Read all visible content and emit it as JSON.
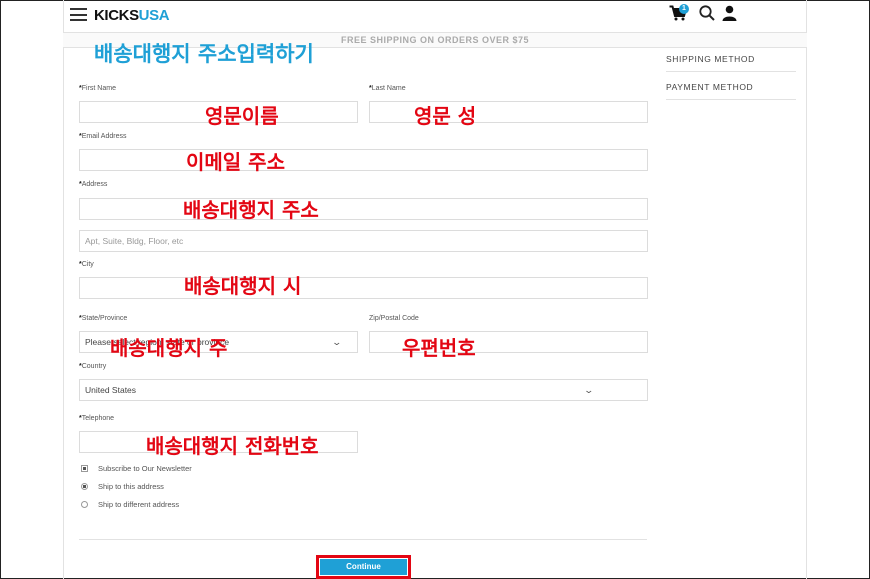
{
  "header": {
    "logo_main": "KICKS",
    "logo_accent": "USA",
    "cart_count": "1"
  },
  "promo": {
    "text": "FREE SHIPPING ON ORDERS OVER $75"
  },
  "sidebar": {
    "items": [
      {
        "label": "SHIPPING METHOD"
      },
      {
        "label": "PAYMENT METHOD"
      }
    ]
  },
  "form": {
    "required_mark": "*",
    "first_name_label": "First Name",
    "last_name_label": "Last Name",
    "email_label": "Email Address",
    "address_label": "Address",
    "address2_placeholder": "Apt, Suite, Bldg, Floor, etc",
    "city_label": "City",
    "state_label": "State/Province",
    "state_value": "Please select region, state or province",
    "zip_label": "Zip/Postal Code",
    "country_label": "Country",
    "country_value": "United States",
    "telephone_label": "Telephone",
    "newsletter_label": "Subscribe to Our Newsletter",
    "ship_same_label": "Ship to this address",
    "ship_diff_label": "Ship to different address",
    "continue_label": "Continue"
  },
  "annotations": {
    "title": "배송대행지 주소입력하기",
    "first_name": "영문이름",
    "last_name": "영문 성",
    "email": "이메일 주소",
    "address": "배송대행지 주소",
    "city": "배송대행지 시",
    "state": "배송대행지 주",
    "zip": "우편번호",
    "telephone": "배송대행지 전화번호"
  },
  "colors": {
    "accent": "#1fa0d6",
    "annotation_red": "#e30613"
  }
}
